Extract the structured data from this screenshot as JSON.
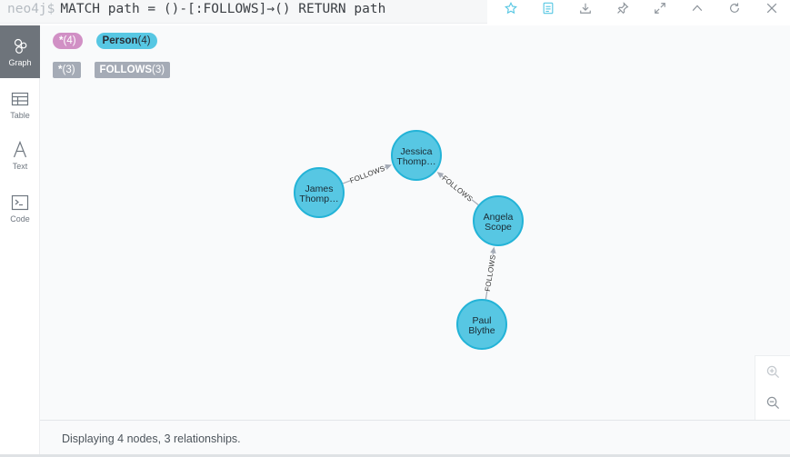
{
  "query": {
    "prompt": "neo4j$",
    "text": "MATCH path = ()-[:FOLLOWS]→() RETURN path"
  },
  "toolbar": {
    "icons": [
      "star-icon",
      "save-icon",
      "download-icon",
      "pin-icon",
      "expand-icon",
      "collapse-icon",
      "rerun-icon",
      "close-icon"
    ]
  },
  "sidebar": {
    "items": [
      {
        "label": "Graph",
        "icon": "graph-icon",
        "active": true
      },
      {
        "label": "Table",
        "icon": "table-icon",
        "active": false
      },
      {
        "label": "Text",
        "icon": "text-icon",
        "active": false
      },
      {
        "label": "Code",
        "icon": "code-icon",
        "active": false
      }
    ]
  },
  "legend": {
    "nodes": [
      {
        "name": "*",
        "count": "(4)",
        "color": "#d190c5",
        "text_color": "#ffffff"
      },
      {
        "name": "Person",
        "count": "(4)",
        "color": "#57c7e3",
        "text_color": "#2a2c34"
      }
    ],
    "relationships": [
      {
        "name": "*",
        "count": "(3)",
        "color": "#a5abb6",
        "text_color": "#ffffff"
      },
      {
        "name": "FOLLOWS",
        "count": "(3)",
        "color": "#a5abb6",
        "text_color": "#ffffff"
      }
    ]
  },
  "graph": {
    "node_color": "#57c7e3",
    "node_border": "#23b3d7",
    "nodes": [
      {
        "id": "jessica",
        "line1": "Jessica",
        "line2": "Thomp…"
      },
      {
        "id": "james",
        "line1": "James",
        "line2": "Thomp…"
      },
      {
        "id": "angela",
        "line1": "Angela",
        "line2": "Scope"
      },
      {
        "id": "paul",
        "line1": "Paul",
        "line2": "Blythe"
      }
    ],
    "relationships": [
      {
        "from": "james",
        "to": "jessica",
        "type": "FOLLOWS"
      },
      {
        "from": "angela",
        "to": "jessica",
        "type": "FOLLOWS"
      },
      {
        "from": "paul",
        "to": "angela",
        "type": "FOLLOWS"
      }
    ]
  },
  "zoom": {
    "icons": [
      "zoom-in-icon",
      "zoom-out-icon"
    ]
  },
  "status": {
    "text": "Displaying 4 nodes, 3 relationships."
  }
}
